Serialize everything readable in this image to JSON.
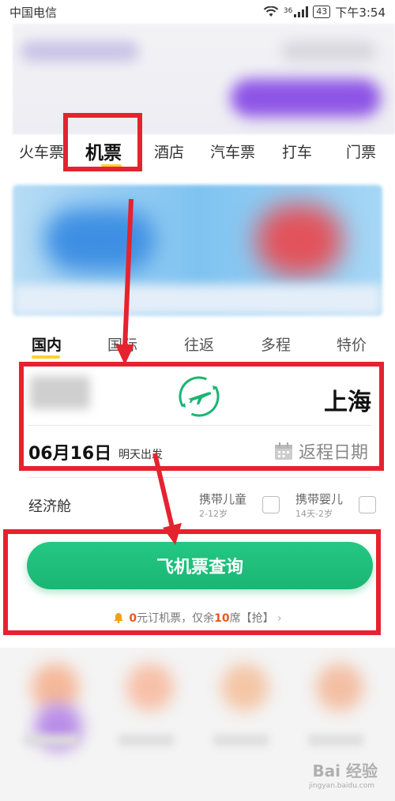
{
  "status_bar": {
    "carrier": "中国电信",
    "network": "36",
    "battery": "43",
    "time": "下午3:54"
  },
  "category_tabs": [
    {
      "label": "火车票"
    },
    {
      "label": "机票"
    },
    {
      "label": "酒店"
    },
    {
      "label": "汽车票"
    },
    {
      "label": "打车"
    },
    {
      "label": "门票"
    }
  ],
  "flight_tabs": [
    {
      "label": "国内"
    },
    {
      "label": "国际"
    },
    {
      "label": "往返"
    },
    {
      "label": "多程"
    },
    {
      "label": "特价"
    }
  ],
  "route": {
    "to_city": "上海"
  },
  "date": {
    "depart": "06月16日",
    "depart_sub": "明天出发",
    "return_placeholder": "返程日期"
  },
  "cabin": {
    "class": "经济舱",
    "child": {
      "label": "携带儿童",
      "sub": "2-12岁"
    },
    "infant": {
      "label": "携带婴儿",
      "sub": "14天-2岁"
    }
  },
  "search_button": "飞机票查询",
  "promo": {
    "price": "0",
    "text1": "元订机票，仅余",
    "seats": "10",
    "text2": "席【抢】",
    "chevron": "›"
  },
  "watermark": {
    "main": "Bai 经验",
    "sub": "jingyan.baidu.com"
  },
  "colors": {
    "primary_green": "#1bb574",
    "accent_yellow": "#ffcf33",
    "annotation_red": "#e5232f"
  }
}
